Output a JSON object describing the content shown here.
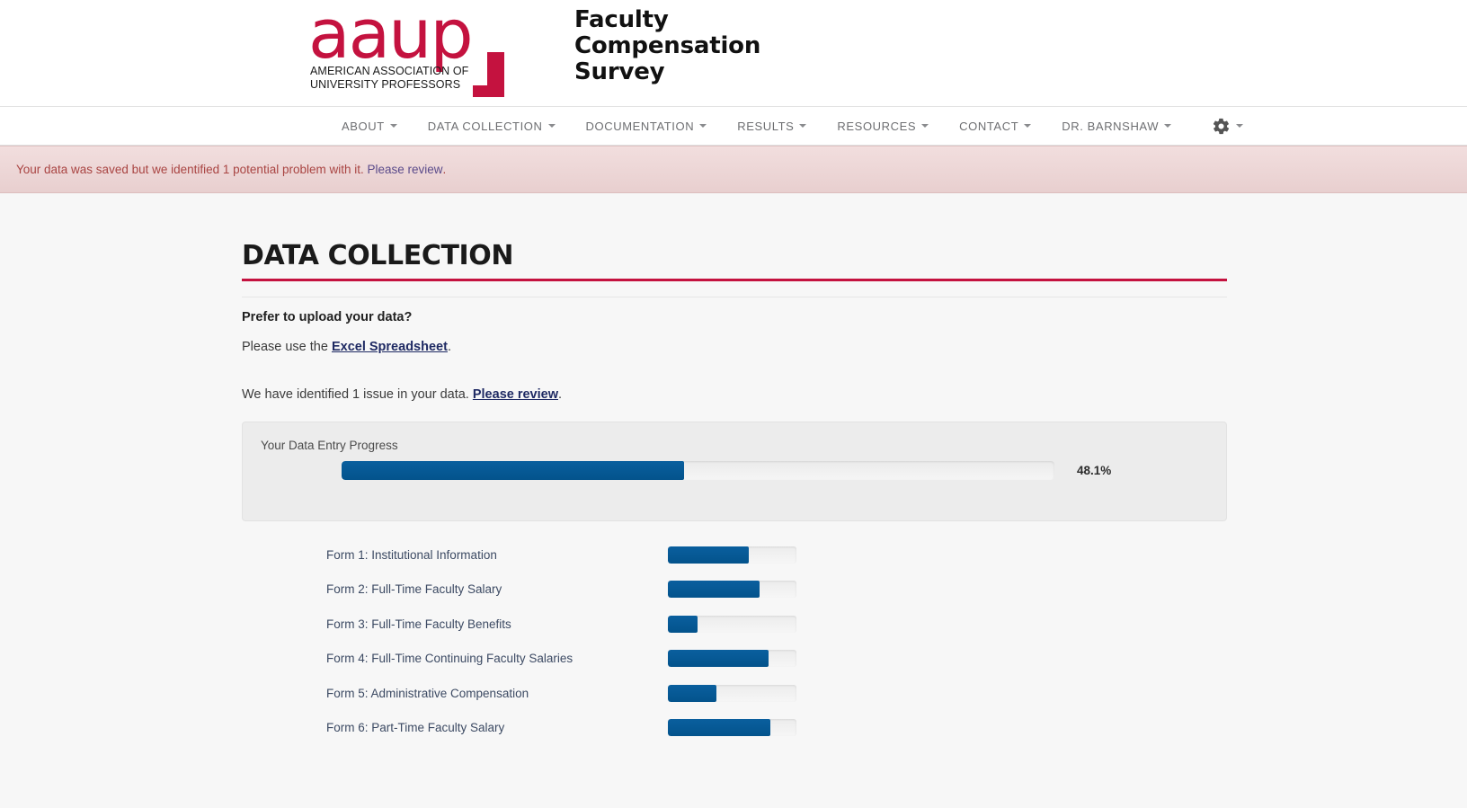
{
  "header": {
    "logo_wordmark": "aaup",
    "logo_tagline": "AMERICAN ASSOCIATION OF\nUNIVERSITY PROFESSORS",
    "site_title": "Faculty\nCompensation\nSurvey"
  },
  "nav": {
    "items": [
      {
        "label": "ABOUT",
        "has_caret": true
      },
      {
        "label": "DATA COLLECTION",
        "has_caret": true
      },
      {
        "label": "DOCUMENTATION",
        "has_caret": true
      },
      {
        "label": "RESULTS",
        "has_caret": true
      },
      {
        "label": "RESOURCES",
        "has_caret": true
      },
      {
        "label": "CONTACT",
        "has_caret": true
      },
      {
        "label": "DR. BARNSHAW",
        "has_caret": true
      }
    ],
    "settings_icon": "gear-icon"
  },
  "alert": {
    "message": "Your data was saved but we identified 1 potential problem with it.",
    "link_text": "Please review",
    "trailing": ".",
    "background_color": "#f2dede",
    "text_color": "#a94442"
  },
  "main": {
    "page_title": "DATA COLLECTION",
    "accent_color": "#c4123f",
    "upload_prompt": "Prefer to upload your data?",
    "upload_text_before": "Please use the ",
    "upload_link": "Excel Spreadsheet",
    "upload_text_after": ".",
    "issue_text_before": "We have identified 1 issue in your data. ",
    "issue_link": "Please review",
    "issue_text_after": ".",
    "progress": {
      "panel_label": "Your Data Entry Progress",
      "overall_percent_label": "48.1%",
      "overall_percent_value": 48.1,
      "bar_color": "#03538c"
    },
    "forms": [
      {
        "label": "Form 1: Institutional Information",
        "percent": 63
      },
      {
        "label": "Form 2: Full-Time Faculty Salary",
        "percent": 71
      },
      {
        "label": "Form 3: Full-Time Faculty Benefits",
        "percent": 23
      },
      {
        "label": "Form 4: Full-Time Continuing Faculty Salaries",
        "percent": 78
      },
      {
        "label": "Form 5: Administrative Compensation",
        "percent": 38
      },
      {
        "label": "Form 6: Part-Time Faculty Salary",
        "percent": 80
      }
    ]
  }
}
